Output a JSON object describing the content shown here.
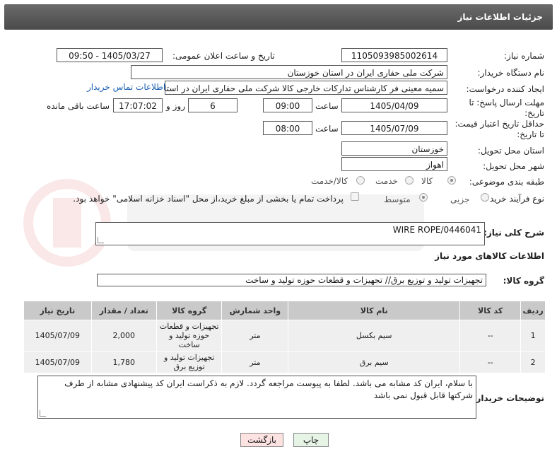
{
  "header": {
    "title": "جزئیات اطلاعات نیاز"
  },
  "fields": {
    "need_number_label": "شماره نیاز:",
    "need_number": "1105093985002614",
    "announce_label": "تاریخ و ساعت اعلان عمومی:",
    "announce_value": "1405/03/27 - 09:50",
    "buyer_org_label": "نام دستگاه خریدار:",
    "buyer_org": "شرکت ملی حفاری ایران در استان خوزستان",
    "creator_label": "ایجاد کننده درخواست:",
    "creator": "سمیه معینی فر کارشناس تدارکات خارجی کالا شرکت ملی حفاری ایران در استان خوزستان",
    "contact_link": "اطلاعات تماس خریدار",
    "deadline_label": "مهلت ارسال پاسخ: تا تاریخ:",
    "deadline_date": "1405/04/09",
    "time_label": "ساعت",
    "deadline_time": "09:00",
    "days_value": "6",
    "days_label": "روز و",
    "remaining_time": "17:07:02",
    "remaining_label": "ساعت باقی مانده",
    "validity_label": "حداقل تاریخ اعتبار قیمت: تا تاریخ:",
    "validity_date": "1405/07/09",
    "validity_time_label": "ساعت",
    "validity_time": "08:00",
    "province_label": "استان محل تحویل:",
    "province": "خوزستان",
    "city_label": "شهر محل تحویل:",
    "city": "اهواز",
    "category_label": "طبقه بندی موضوعی:",
    "category_options": [
      "کالا",
      "خدمت",
      "کالا/خدمت"
    ],
    "process_label": "نوع فرآیند خرید :",
    "process_options": [
      "جزیی",
      "متوسط"
    ],
    "payment_note": "پرداخت تمام یا بخشی از مبلغ خرید،از محل \"اسناد خزانه اسلامی\" خواهد بود."
  },
  "description": {
    "label": "شرح کلی نیاز:",
    "value": "WIRE ROPE/0446041"
  },
  "goods_section": {
    "title": "اطلاعات کالاهای مورد نیاز",
    "group_label": "گروه کالا:",
    "group_value": "تجهیزات تولید و توزیع برق// تجهیزات و قطعات حوزه تولید و ساخت"
  },
  "table": {
    "headers": [
      "ردیف",
      "کد کالا",
      "نام کالا",
      "واحد شمارش",
      "گروه کالا",
      "تعداد / مقدار",
      "تاریخ نیاز"
    ],
    "rows": [
      [
        "1",
        "--",
        "سیم بکسل",
        "متر",
        "تجهیزات و قطعات حوزه تولید و ساخت",
        "2,000",
        "1405/07/09"
      ],
      [
        "2",
        "--",
        "سیم برق",
        "متر",
        "تجهیزات تولید و توزیع برق",
        "1,780",
        "1405/07/09"
      ]
    ]
  },
  "buyer_notes": {
    "label": "توضیحات خریدار:",
    "value": "با سلام، ایران کد مشابه می باشد. لطفا به پیوست مراجعه گردد. لازم به ذکراست ایران کد پیشنهادی مشابه از طرف شرکتها قابل قبول نمی باشد"
  },
  "buttons": {
    "print": "چاپ",
    "back": "بازگشت"
  },
  "colors": {
    "header_bg": "#5a5a5a",
    "link": "#1a5fb4",
    "back_button_bg": "#fde2e2",
    "print_button_bg": "#e6f4e6"
  }
}
